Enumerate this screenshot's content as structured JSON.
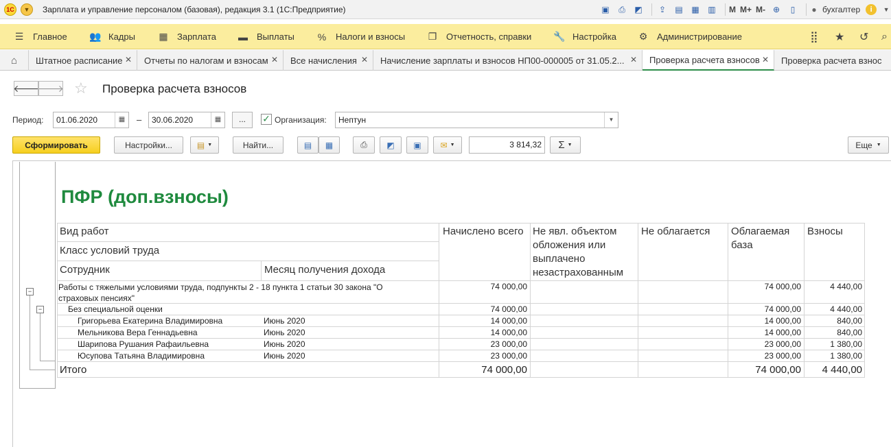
{
  "window": {
    "title": "Зарплата и управление персоналом (базовая), редакция 3.1  (1С:Предприятие)",
    "user": "бухгалтер",
    "mtools": [
      "M",
      "M+",
      "M-"
    ]
  },
  "sections": [
    {
      "label": "Главное",
      "icon": "menu-icon"
    },
    {
      "label": "Кадры",
      "icon": "people-icon"
    },
    {
      "label": "Зарплата",
      "icon": "calculator-icon"
    },
    {
      "label": "Выплаты",
      "icon": "wallet-icon"
    },
    {
      "label": "Налоги и взносы",
      "icon": "percent-icon"
    },
    {
      "label": "Отчетность, справки",
      "icon": "documents-icon"
    },
    {
      "label": "Настройка",
      "icon": "wrench-icon"
    },
    {
      "label": "Администрирование",
      "icon": "gear-icon"
    }
  ],
  "tabs": [
    {
      "label": "Штатное расписание"
    },
    {
      "label": "Отчеты по налогам и взносам"
    },
    {
      "label": "Все начисления"
    },
    {
      "label": "Начисление зарплаты и взносов НП00-000005 от 31.05.2..."
    },
    {
      "label": "Проверка расчета взносов",
      "active": true
    },
    {
      "label": "Проверка расчета взнос"
    }
  ],
  "form": {
    "title": "Проверка расчета взносов",
    "period_label": "Период:",
    "date_from": "01.06.2020",
    "date_to": "30.06.2020",
    "dash": "–",
    "dots": "...",
    "org_checked": true,
    "org_label": "Организация:",
    "org_value": "Нептун"
  },
  "toolbar": {
    "generate": "Сформировать",
    "settings": "Настройки...",
    "find": "Найти...",
    "sum_value": "3 814,32",
    "more": "Еще"
  },
  "report": {
    "title": "ПФР (доп.взносы)",
    "headers": {
      "work_type": "Вид работ",
      "labor_class": "Класс условий труда",
      "employee": "Сотрудник",
      "income_month": "Месяц получения дохода",
      "accrued": "Начислено всего",
      "not_object": "Не явл. объектом обложения или выплачено незастрахованным",
      "not_taxed": "Не облагается",
      "base": "Облагаемая база",
      "contrib": "Взносы"
    },
    "group": {
      "label": "Работы с тяжелыми условиями труда, подпункты 2 - 18 пункта 1 статьи 30 закона \"О страховых пенсиях\"",
      "accrued": "74 000,00",
      "base": "74 000,00",
      "contrib": "4 440,00"
    },
    "subgroup": {
      "label": "Без специальной оценки",
      "accrued": "74 000,00",
      "base": "74 000,00",
      "contrib": "4 440,00"
    },
    "rows": [
      {
        "name": "Григорьева Екатерина Владимировна",
        "month": "Июнь 2020",
        "accrued": "14 000,00",
        "base": "14 000,00",
        "contrib": "840,00"
      },
      {
        "name": "Мельникова Вера Геннадьевна",
        "month": "Июнь 2020",
        "accrued": "14 000,00",
        "base": "14 000,00",
        "contrib": "840,00"
      },
      {
        "name": "Шарипова Рушания Рафаильевна",
        "month": "Июнь 2020",
        "accrued": "23 000,00",
        "base": "23 000,00",
        "contrib": "1 380,00"
      },
      {
        "name": "Юсупова Татьяна Владимировна",
        "month": "Июнь 2020",
        "accrued": "23 000,00",
        "base": "23 000,00",
        "contrib": "1 380,00"
      }
    ],
    "total": {
      "label": "Итого",
      "accrued": "74 000,00",
      "base": "74 000,00",
      "contrib": "4 440,00"
    }
  },
  "colors": {
    "accent_green": "#1f8a3e",
    "section_bar": "#fbed9e",
    "primary_button": "#f6cf1f"
  }
}
